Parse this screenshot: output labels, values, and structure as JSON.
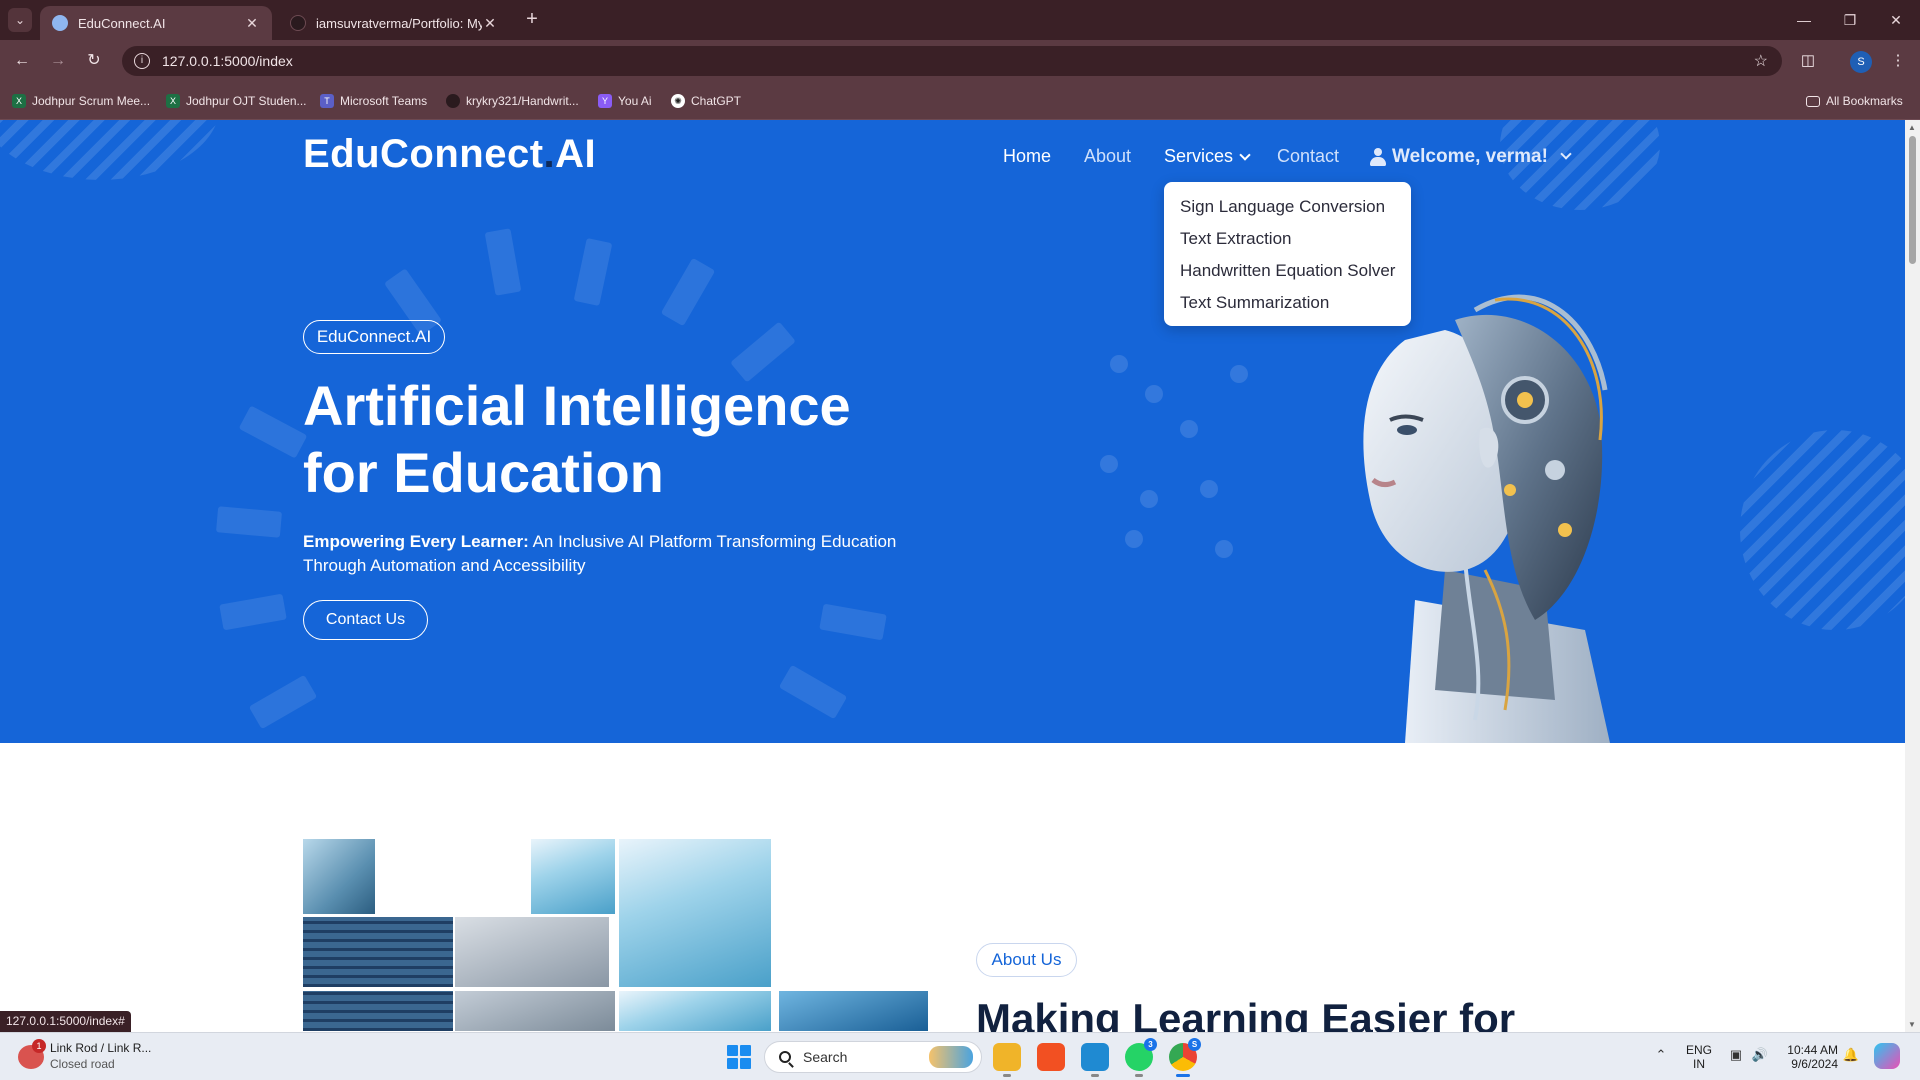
{
  "browser": {
    "tabs": [
      {
        "title": "EduConnect.AI",
        "active": true
      },
      {
        "title": "iamsuvratverma/Portfolio: My p",
        "active": false
      }
    ],
    "new_tab": "+",
    "url": "127.0.0.1:5000/index",
    "profile_initial": "S",
    "bookmarks": [
      {
        "label": "Jodhpur Scrum Mee...",
        "icon": "excel-icon"
      },
      {
        "label": "Jodhpur OJT Studen...",
        "icon": "excel-icon"
      },
      {
        "label": "Microsoft Teams",
        "icon": "teams-icon"
      },
      {
        "label": "krykry321/Handwrit...",
        "icon": "github-icon"
      },
      {
        "label": "You Ai",
        "icon": "you-icon"
      },
      {
        "label": "ChatGPT",
        "icon": "chatgpt-icon"
      }
    ],
    "all_bookmarks": "All Bookmarks",
    "status_url": "127.0.0.1:5000/index#"
  },
  "site": {
    "logo_main": "EduConnect",
    "logo_dot": ".",
    "logo_suffix": "AI",
    "nav": {
      "home": "Home",
      "about": "About",
      "services": "Services",
      "contact": "Contact",
      "welcome": "Welcome, verma!"
    },
    "services_menu": [
      "Sign Language Conversion",
      "Text Extraction",
      "Handwritten Equation Solver",
      "Text Summarization"
    ],
    "hero": {
      "badge": "EduConnect.AI",
      "title_line1": "Artificial Intelligence",
      "title_line2": "for Education",
      "subtitle_bold": "Empowering Every Learner:",
      "subtitle_rest": " An Inclusive AI Platform Transforming Education Through Automation and Accessibility",
      "cta": "Contact Us"
    },
    "about": {
      "badge": "About Us",
      "title": "Making Learning Easier for"
    }
  },
  "taskbar": {
    "weather_title": "Link Rod / Link R...",
    "weather_sub": "Closed road",
    "weather_badge": "1",
    "search_placeholder": "Search",
    "whatsapp_badge": "3",
    "chrome_badge": "S",
    "lang_top": "ENG",
    "lang_bottom": "IN",
    "time": "10:44 AM",
    "date": "9/6/2024"
  },
  "colors": {
    "hero_bg": "#1565d8",
    "chrome_dark": "#3a2026",
    "chrome_mid": "#5b3a42",
    "about_title": "#11213f"
  }
}
